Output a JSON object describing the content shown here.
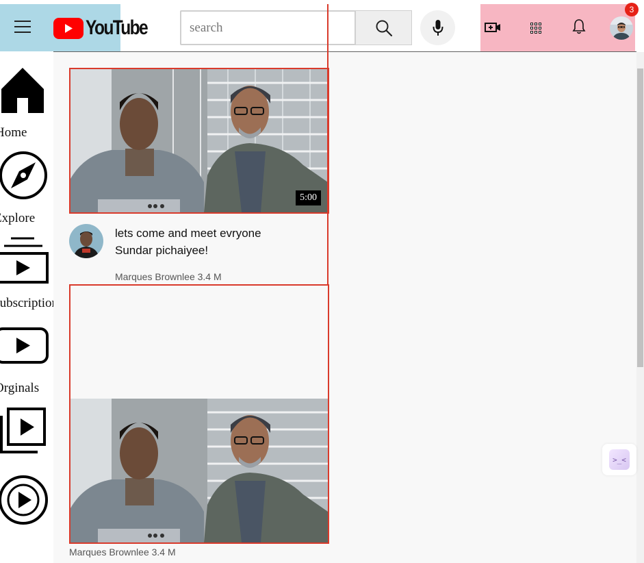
{
  "header": {
    "logo_text": "YouTube",
    "search": {
      "placeholder": "search",
      "value": ""
    },
    "notification_count": "3"
  },
  "sidebar": {
    "items": [
      {
        "label": "Home",
        "icon": "home-icon"
      },
      {
        "label": "Explore",
        "icon": "compass-icon"
      },
      {
        "label": "Subscription",
        "icon": "subscriptions-icon"
      },
      {
        "label": "Orginals",
        "icon": "originals-icon"
      },
      {
        "label": "",
        "icon": "library-icon"
      },
      {
        "label": "",
        "icon": "play-circle-icon"
      }
    ]
  },
  "videos": [
    {
      "title_line1": "lets come and meet evryone",
      "title_line2": "Sundar pichaiyee!",
      "channel_meta": "Marques Brownlee 3.4 M",
      "duration": "5:00"
    },
    {
      "channel_meta": "Marques Brownlee 3.4 M"
    }
  ],
  "colors": {
    "header_left_bg": "#add8e6",
    "header_right_bg": "#f7b6c2",
    "card_border": "#d93a2b",
    "youtube_red": "#ff0000",
    "main_bg": "#f8f8f8"
  }
}
